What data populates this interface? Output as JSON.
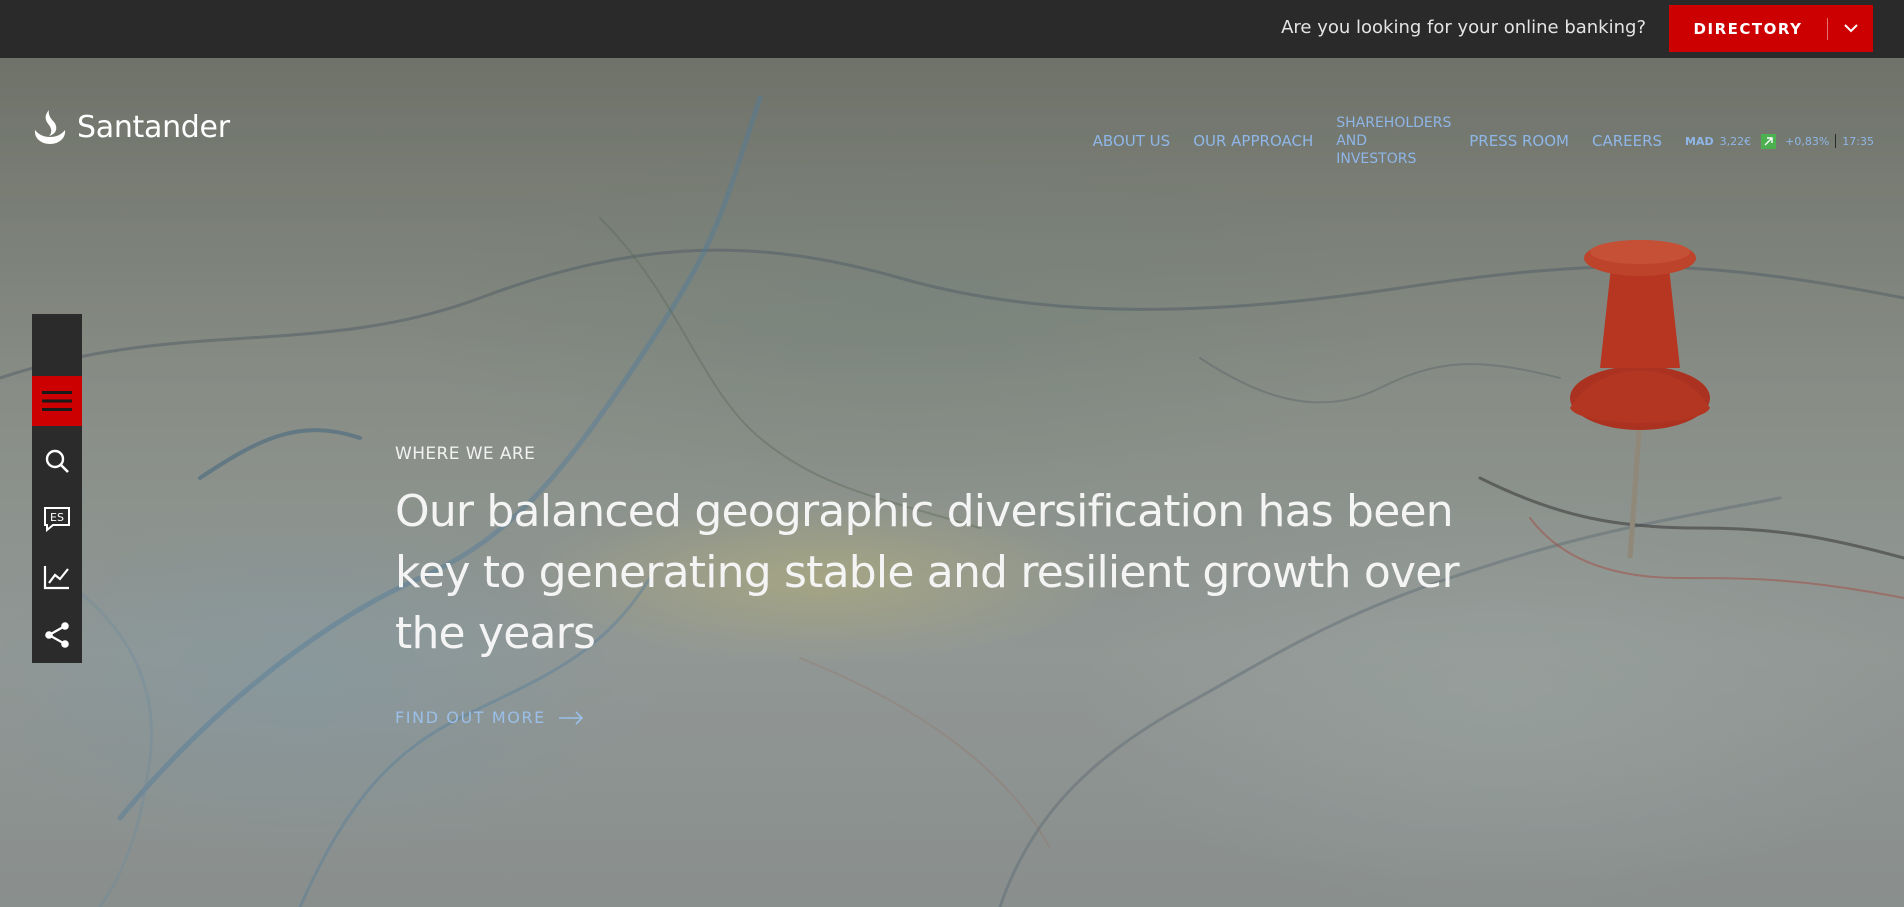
{
  "topbar": {
    "question": "Are you looking for your online banking?",
    "directory_label": "DIRECTORY"
  },
  "header": {
    "logo_text": "Santander",
    "nav": [
      {
        "label": "ABOUT US"
      },
      {
        "label": "OUR APPROACH"
      },
      {
        "label": "SHAREHOLDERS AND INVESTORS"
      },
      {
        "label": "PRESS ROOM"
      },
      {
        "label": "CAREERS"
      }
    ],
    "stock": {
      "ticker": "MAD",
      "price": "3,22€",
      "change": "+0,83%",
      "time": "17:35",
      "trend_color": "#4caf50"
    }
  },
  "sidebar": {
    "items": [
      {
        "icon": "hamburger-menu-icon"
      },
      {
        "icon": "search-icon"
      },
      {
        "icon": "language-icon",
        "label": "ES"
      },
      {
        "icon": "chart-icon"
      },
      {
        "icon": "share-icon"
      }
    ]
  },
  "hero": {
    "eyebrow": "WHERE WE ARE",
    "headline": "Our balanced geographic diversification has been key to generating stable and resilient growth over the years",
    "cta_label": "FIND OUT MORE"
  },
  "colors": {
    "brand_red": "#cc0000",
    "dark_bar": "#2a2a2a",
    "nav_link": "#8fb6e8"
  }
}
